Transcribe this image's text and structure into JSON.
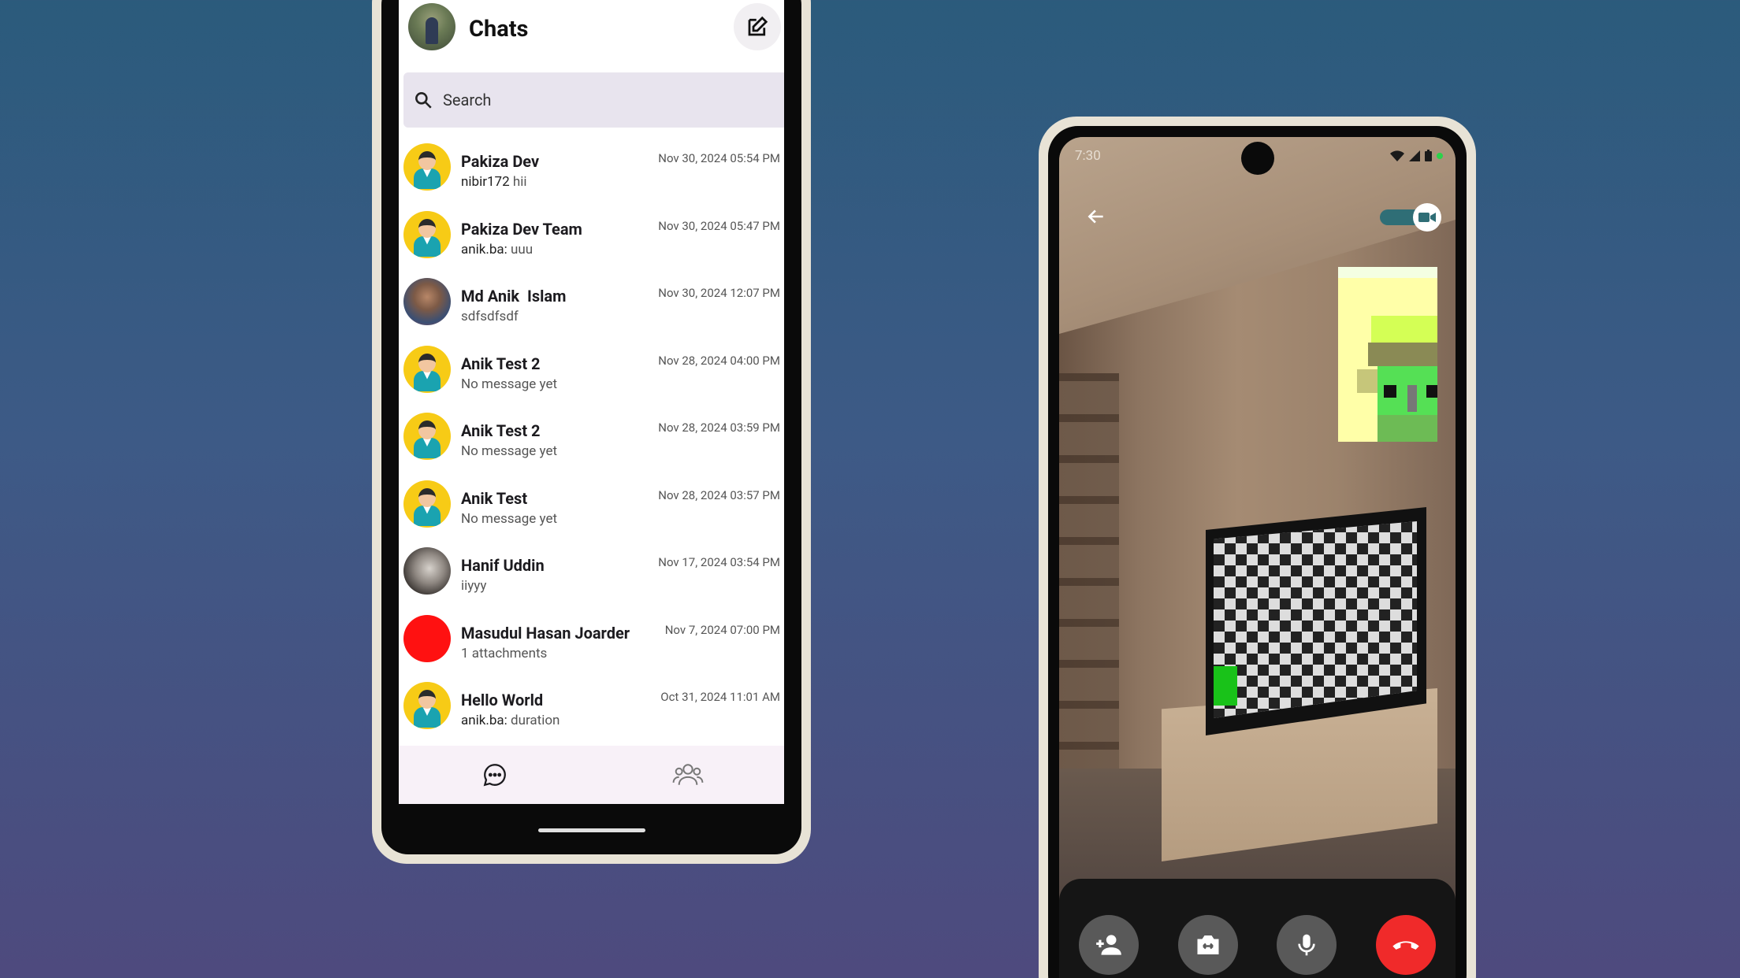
{
  "chats_screen": {
    "title": "Chats",
    "search_placeholder": "Search",
    "chats": [
      {
        "name": "Pakiza Dev",
        "sender": "nibir172",
        "message": "hii",
        "time": "Nov 30, 2024 05:54 PM",
        "avatar": "yellow"
      },
      {
        "name": "Pakiza Dev Team",
        "sender": "anik.ba:",
        "message": "uuu",
        "time": "Nov 30, 2024 05:47 PM",
        "avatar": "yellow"
      },
      {
        "name": "Md Anik  Islam",
        "sender": "",
        "message": "sdfsdfsdf",
        "time": "Nov 30, 2024 12:07 PM",
        "avatar": "photo1"
      },
      {
        "name": "Anik Test 2",
        "sender": "",
        "message": "No message yet",
        "time": "Nov 28, 2024 04:00 PM",
        "avatar": "yellow"
      },
      {
        "name": "Anik Test 2",
        "sender": "",
        "message": "No message yet",
        "time": "Nov 28, 2024 03:59 PM",
        "avatar": "yellow"
      },
      {
        "name": "Anik Test",
        "sender": "",
        "message": "No message yet",
        "time": "Nov 28, 2024 03:57 PM",
        "avatar": "yellow"
      },
      {
        "name": "Hanif Uddin",
        "sender": "",
        "message": "iiyyy",
        "time": "Nov 17, 2024 03:54 PM",
        "avatar": "photo2"
      },
      {
        "name": "Masudul Hasan Joarder",
        "sender": "",
        "message": "1 attachments",
        "time": "Nov 7, 2024 07:00 PM",
        "avatar": "red"
      },
      {
        "name": "Hello World",
        "sender": "anik.ba:",
        "message": "duration",
        "time": "Oct 31, 2024 11:01 AM",
        "avatar": "yellow"
      }
    ],
    "nav": [
      "chat-bubble-icon",
      "group-icon"
    ]
  },
  "call_screen": {
    "clock": "7:30",
    "controls": [
      "add-person-icon",
      "switch-camera-icon",
      "mic-icon",
      "end-call-icon"
    ]
  },
  "colors": {
    "avatar_yellow": "#f7cb16",
    "avatar_red": "#ff1111",
    "search_bg": "#e8e4ee",
    "end_call": "#f02a2a",
    "toggle_track": "#2f6e76"
  }
}
